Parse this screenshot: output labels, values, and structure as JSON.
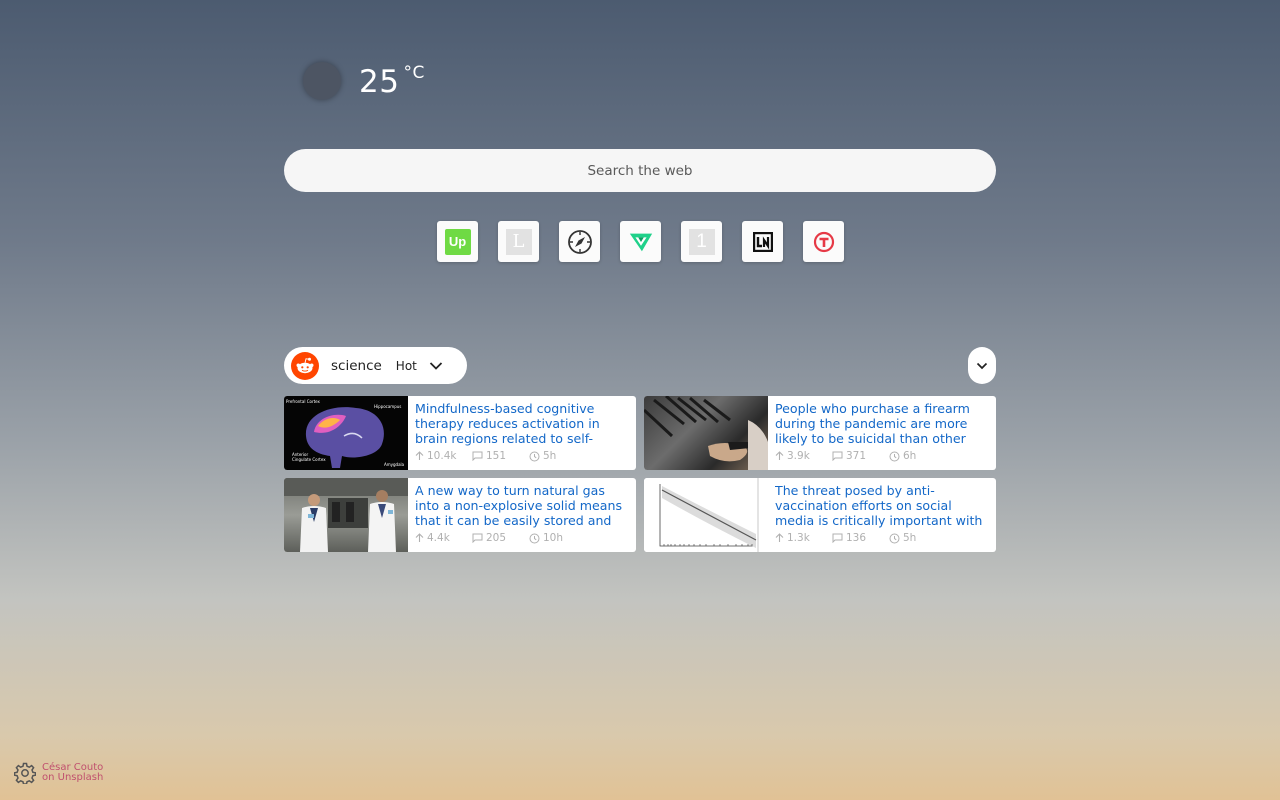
{
  "weather": {
    "temperature": "25",
    "unit": "°C"
  },
  "search": {
    "placeholder": "Search the web"
  },
  "shortcuts": [
    {
      "name": "upwork",
      "icon": "upwork-icon",
      "label": "Up"
    },
    {
      "name": "l",
      "icon": "l-icon",
      "label": "L"
    },
    {
      "name": "compass",
      "icon": "compass-icon",
      "label": ""
    },
    {
      "name": "v",
      "icon": "v-icon",
      "label": ""
    },
    {
      "name": "one",
      "icon": "one-icon",
      "label": "1"
    },
    {
      "name": "ln",
      "icon": "ln-icon",
      "label": ""
    },
    {
      "name": "t",
      "icon": "t-icon",
      "label": ""
    }
  ],
  "reddit": {
    "subreddit": "science",
    "sort": "Hot"
  },
  "posts": [
    {
      "title": "Mindfulness-based cognitive therapy reduces activation in brain regions related to self-",
      "upvotes": "10.4k",
      "comments": "151",
      "age": "5h"
    },
    {
      "title": "People who purchase a firearm during the pandemic are more likely to be suicidal than other",
      "upvotes": "3.9k",
      "comments": "371",
      "age": "6h"
    },
    {
      "title": "A new way to turn natural gas into a non-explosive solid means that it can be easily stored and",
      "upvotes": "4.4k",
      "comments": "205",
      "age": "10h"
    },
    {
      "title": "The threat posed by anti-vaccination efforts on social media is critically important with",
      "upvotes": "1.3k",
      "comments": "136",
      "age": "5h"
    }
  ],
  "credit": {
    "line1": "César Couto",
    "line2": "on Unsplash"
  },
  "colors": {
    "link": "#1468c8",
    "reddit": "#ff4500",
    "credit": "#c0506e"
  }
}
